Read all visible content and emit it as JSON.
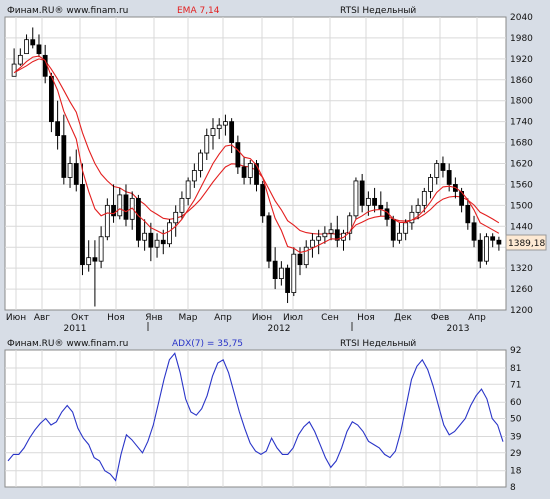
{
  "colors": {
    "background": "#d7dde6",
    "plot_bg": "#ffffff",
    "candle_up": "#ffffff",
    "candle_down": "#000000",
    "ema": "#e32020",
    "adx": "#2a35c8",
    "last_price_box": "#fde9d3"
  },
  "top_panel": {
    "source": "Финам.RU®  www.finam.ru",
    "indicator": "EMA 7,14",
    "instrument": "RTSI Недельный",
    "last_price": "1389,18"
  },
  "bottom_panel": {
    "source": "Финам.RU®  www.finam.ru",
    "indicator": "ADX(7) = 35,75",
    "instrument": "RTSI Недельный"
  },
  "chart_data": [
    {
      "type": "candlestick",
      "series_name": "RTSI Недельный",
      "ylim": [
        1200,
        2040
      ],
      "y_ticks": [
        "2040",
        "1980",
        "1920",
        "1860",
        "1800",
        "1740",
        "1680",
        "1620",
        "1560",
        "1500",
        "1440",
        "1380",
        "1320",
        "1260",
        "1200"
      ],
      "x_month_labels": [
        "Июн",
        "Авг",
        "Окт",
        "Ноя",
        "Янв",
        "Мар",
        "Апр",
        "Июн",
        "Июл",
        "Сен",
        "Ноя",
        "Дек",
        "Фев",
        "Апр"
      ],
      "x_year_labels": [
        "2011",
        "2012",
        "2013"
      ],
      "candles": [
        [
          1870,
          1950,
          1880,
          1905
        ],
        [
          1905,
          1950,
          1900,
          1930
        ],
        [
          1935,
          1990,
          1940,
          1975
        ],
        [
          1975,
          2010,
          1950,
          1960
        ],
        [
          1960,
          1990,
          1925,
          1935
        ],
        [
          1930,
          1960,
          1850,
          1870
        ],
        [
          1870,
          1880,
          1710,
          1740
        ],
        [
          1740,
          1800,
          1660,
          1700
        ],
        [
          1700,
          1760,
          1560,
          1580
        ],
        [
          1580,
          1640,
          1550,
          1620
        ],
        [
          1620,
          1660,
          1540,
          1560
        ],
        [
          1560,
          1620,
          1300,
          1330
        ],
        [
          1330,
          1400,
          1310,
          1350
        ],
        [
          1350,
          1400,
          1210,
          1340
        ],
        [
          1340,
          1440,
          1320,
          1410
        ],
        [
          1410,
          1520,
          1400,
          1500
        ],
        [
          1500,
          1560,
          1450,
          1470
        ],
        [
          1470,
          1550,
          1460,
          1530
        ],
        [
          1530,
          1560,
          1440,
          1460
        ],
        [
          1460,
          1540,
          1430,
          1520
        ],
        [
          1520,
          1530,
          1380,
          1400
        ],
        [
          1400,
          1460,
          1370,
          1420
        ],
        [
          1420,
          1450,
          1340,
          1380
        ],
        [
          1380,
          1420,
          1350,
          1400
        ],
        [
          1400,
          1430,
          1360,
          1390
        ],
        [
          1390,
          1460,
          1380,
          1450
        ],
        [
          1450,
          1500,
          1410,
          1480
        ],
        [
          1480,
          1540,
          1460,
          1520
        ],
        [
          1520,
          1580,
          1500,
          1570
        ],
        [
          1570,
          1620,
          1550,
          1600
        ],
        [
          1600,
          1660,
          1580,
          1650
        ],
        [
          1650,
          1720,
          1630,
          1700
        ],
        [
          1700,
          1750,
          1660,
          1720
        ],
        [
          1720,
          1750,
          1690,
          1730
        ],
        [
          1730,
          1760,
          1700,
          1740
        ],
        [
          1740,
          1750,
          1650,
          1680
        ],
        [
          1680,
          1700,
          1590,
          1610
        ],
        [
          1610,
          1640,
          1560,
          1580
        ],
        [
          1580,
          1630,
          1560,
          1620
        ],
        [
          1620,
          1630,
          1540,
          1560
        ],
        [
          1560,
          1570,
          1450,
          1470
        ],
        [
          1470,
          1480,
          1320,
          1340
        ],
        [
          1340,
          1380,
          1260,
          1290
        ],
        [
          1290,
          1340,
          1270,
          1320
        ],
        [
          1320,
          1330,
          1220,
          1250
        ],
        [
          1250,
          1380,
          1240,
          1360
        ],
        [
          1360,
          1380,
          1300,
          1330
        ],
        [
          1330,
          1400,
          1320,
          1380
        ],
        [
          1380,
          1420,
          1350,
          1400
        ],
        [
          1400,
          1430,
          1360,
          1410
        ],
        [
          1410,
          1440,
          1390,
          1420
        ],
        [
          1420,
          1450,
          1400,
          1430
        ],
        [
          1430,
          1470,
          1380,
          1400
        ],
        [
          1400,
          1430,
          1370,
          1420
        ],
        [
          1420,
          1480,
          1400,
          1470
        ],
        [
          1470,
          1580,
          1460,
          1570
        ],
        [
          1570,
          1590,
          1480,
          1500
        ],
        [
          1500,
          1540,
          1470,
          1520
        ],
        [
          1520,
          1550,
          1480,
          1500
        ],
        [
          1500,
          1540,
          1470,
          1490
        ],
        [
          1490,
          1510,
          1440,
          1460
        ],
        [
          1460,
          1470,
          1380,
          1400
        ],
        [
          1400,
          1450,
          1390,
          1420
        ],
        [
          1420,
          1460,
          1400,
          1450
        ],
        [
          1450,
          1500,
          1430,
          1480
        ],
        [
          1480,
          1520,
          1460,
          1500
        ],
        [
          1500,
          1550,
          1480,
          1540
        ],
        [
          1540,
          1590,
          1520,
          1580
        ],
        [
          1580,
          1630,
          1560,
          1620
        ],
        [
          1620,
          1640,
          1580,
          1600
        ],
        [
          1600,
          1620,
          1540,
          1560
        ],
        [
          1560,
          1580,
          1520,
          1540
        ],
        [
          1540,
          1550,
          1480,
          1500
        ],
        [
          1500,
          1520,
          1430,
          1450
        ],
        [
          1450,
          1470,
          1380,
          1400
        ],
        [
          1400,
          1420,
          1320,
          1340
        ],
        [
          1340,
          1420,
          1330,
          1410
        ],
        [
          1410,
          1420,
          1380,
          1400
        ],
        [
          1400,
          1410,
          1370,
          1389
        ]
      ],
      "ema_fast": [
        1880,
        1895,
        1912,
        1925,
        1928,
        1915,
        1870,
        1830,
        1770,
        1730,
        1690,
        1600,
        1540,
        1490,
        1470,
        1478,
        1476,
        1490,
        1482,
        1492,
        1470,
        1455,
        1436,
        1427,
        1418,
        1426,
        1440,
        1460,
        1488,
        1515,
        1550,
        1585,
        1620,
        1647,
        1670,
        1673,
        1658,
        1638,
        1634,
        1615,
        1580,
        1520,
        1463,
        1428,
        1382,
        1377,
        1365,
        1369,
        1377,
        1386,
        1395,
        1404,
        1403,
        1408,
        1423,
        1460,
        1470,
        1482,
        1487,
        1488,
        1481,
        1461,
        1451,
        1451,
        1458,
        1469,
        1487,
        1510,
        1537,
        1553,
        1555,
        1551,
        1538,
        1516,
        1487,
        1450,
        1440,
        1430,
        1420
      ],
      "ema_slow": [
        1880,
        1890,
        1900,
        1912,
        1920,
        1915,
        1890,
        1862,
        1830,
        1797,
        1767,
        1708,
        1660,
        1620,
        1590,
        1570,
        1554,
        1550,
        1539,
        1534,
        1516,
        1503,
        1485,
        1474,
        1463,
        1460,
        1463,
        1469,
        1483,
        1499,
        1518,
        1542,
        1567,
        1589,
        1610,
        1619,
        1618,
        1612,
        1610,
        1600,
        1580,
        1547,
        1513,
        1487,
        1456,
        1443,
        1428,
        1422,
        1419,
        1418,
        1418,
        1419,
        1417,
        1418,
        1425,
        1444,
        1452,
        1461,
        1466,
        1469,
        1469,
        1461,
        1456,
        1455,
        1458,
        1463,
        1474,
        1488,
        1506,
        1518,
        1524,
        1526,
        1524,
        1515,
        1501,
        1480,
        1471,
        1461,
        1450
      ]
    },
    {
      "type": "line",
      "series_name": "ADX(7)",
      "ylim": [
        8,
        92
      ],
      "y_ticks": [
        "92",
        "81",
        "71",
        "60",
        "50",
        "39",
        "29",
        "18",
        "8"
      ],
      "values": [
        24,
        28,
        28,
        32,
        38,
        43,
        47,
        50,
        46,
        48,
        54,
        58,
        54,
        44,
        38,
        34,
        26,
        24,
        18,
        16,
        12,
        28,
        40,
        37,
        33,
        29,
        36,
        46,
        60,
        74,
        86,
        90,
        78,
        62,
        54,
        52,
        56,
        64,
        76,
        84,
        86,
        78,
        66,
        54,
        44,
        35,
        30,
        28,
        30,
        38,
        32,
        28,
        28,
        32,
        40,
        45,
        48,
        42,
        34,
        26,
        20,
        24,
        32,
        42,
        48,
        46,
        42,
        36,
        34,
        32,
        28,
        26,
        30,
        42,
        58,
        74,
        82,
        86,
        80,
        70,
        58,
        46,
        40,
        42,
        46,
        50,
        58,
        64,
        68,
        62,
        50,
        46,
        35.75
      ]
    }
  ]
}
